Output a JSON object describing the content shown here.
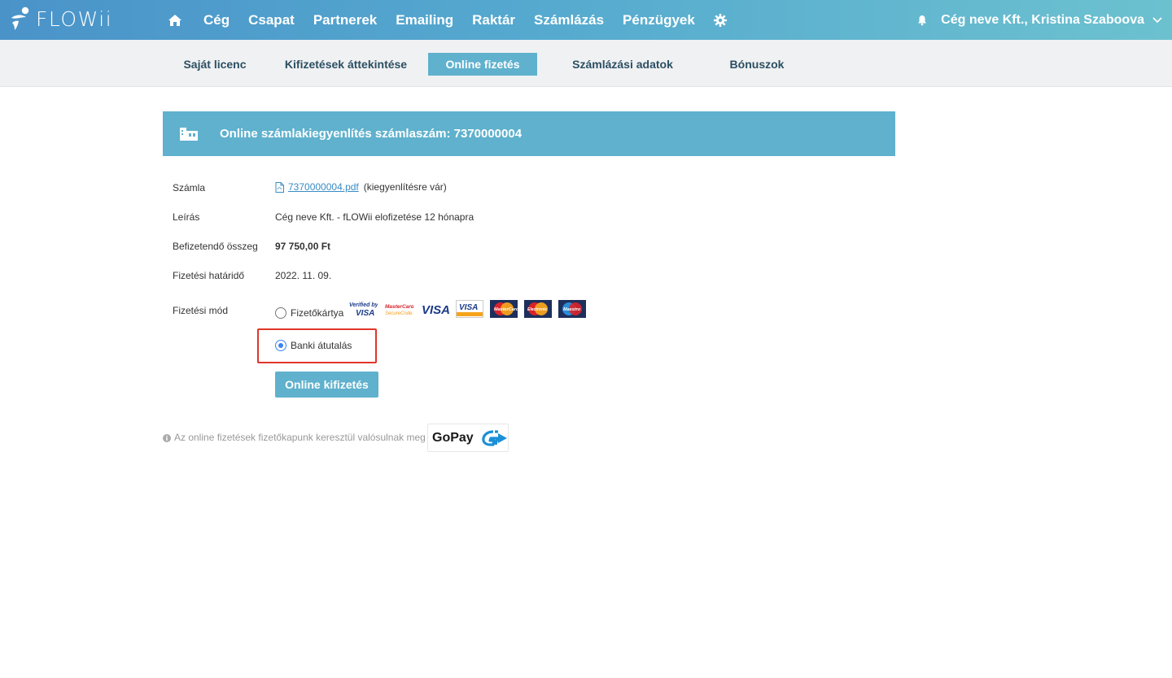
{
  "brand": {
    "name": "FLOWii"
  },
  "topnav": {
    "items": [
      "Cég",
      "Csapat",
      "Partnerek",
      "Emailing",
      "Raktár",
      "Számlázás",
      "Pénzügyek"
    ],
    "user_label": "Cég neve Kft., Kristina Szaboova"
  },
  "subnav": {
    "tabs": [
      "Saját licenc",
      "Kifizetések áttekintése",
      "Online fizetés",
      "Számlázási adatok",
      "Bónuszok"
    ],
    "active": "Online fizetés"
  },
  "panel": {
    "title": "Online számlakiegyenlítés számlaszám: 7370000004"
  },
  "details": {
    "invoice_label": "Számla",
    "invoice_file": "7370000004.pdf",
    "invoice_status": "(kiegyenlítésre vár)",
    "description_label": "Leírás",
    "description_value": "Cég neve Kft. - fLOWii elofizetése 12 hónapra",
    "amount_label": "Befizetendő összeg",
    "amount_value": "97 750,00 Ft",
    "due_label": "Fizetési határidő",
    "due_value": "2022. 11. 09.",
    "method_label": "Fizetési mód",
    "method_card": "Fizetőkártya",
    "method_bank": "Banki átutalás",
    "selected_method": "Banki átutalás"
  },
  "cards": [
    "Verified by VISA",
    "MasterCard SecureCode",
    "VISA",
    "VISA Electron",
    "MasterCard",
    "MasterCard Electronic",
    "Maestro"
  ],
  "actions": {
    "pay_label": "Online kifizetés"
  },
  "footer": {
    "note": "Az online fizetések fizetőkapunk keresztül valósulnak meg",
    "gopay_label": "GoPay"
  },
  "colors": {
    "accent": "#5fb1cd",
    "link": "#3a8cc4",
    "highlight": "#e0362a"
  }
}
